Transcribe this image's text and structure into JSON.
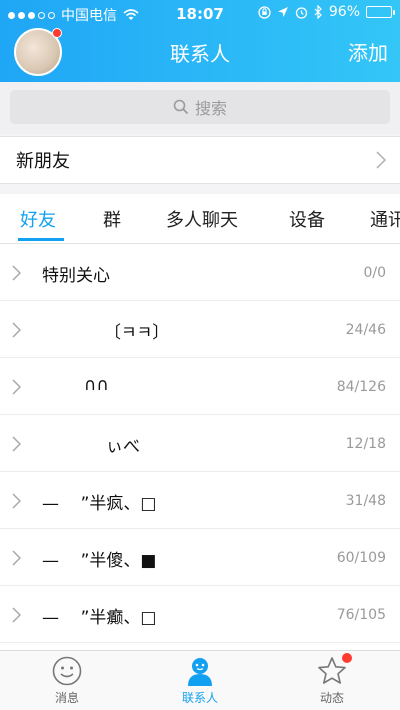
{
  "status_bar": {
    "carrier": "中国电信",
    "time": "18:07",
    "battery_label": "96%",
    "battery_level": 0.96
  },
  "header": {
    "title": "联系人",
    "add_label": "添加"
  },
  "search": {
    "placeholder": "搜索"
  },
  "new_friends": {
    "label": "新朋友"
  },
  "tabs": [
    "好友",
    "群",
    "多人聊天",
    "设备",
    "通讯"
  ],
  "groups": [
    {
      "name": "特别关心",
      "count": "0/0"
    },
    {
      "name": "〔ㅋㅋ〕",
      "count": "24/46"
    },
    {
      "name": "∩∩",
      "count": "84/126"
    },
    {
      "name": "ぃべ",
      "count": "12/18"
    },
    {
      "name": "—    ”半疯、□",
      "count": "31/48"
    },
    {
      "name": "—    ”半傻、■",
      "count": "60/109"
    },
    {
      "name": "—    ”半癫、□",
      "count": "76/105"
    }
  ],
  "tabbar": {
    "messages": "消息",
    "contacts": "联系人",
    "feed": "动态"
  },
  "colors": {
    "accent": "#12a1f0",
    "header_start": "#1fa6f5",
    "header_end": "#33c6f7",
    "badge": "#ff3b30"
  }
}
